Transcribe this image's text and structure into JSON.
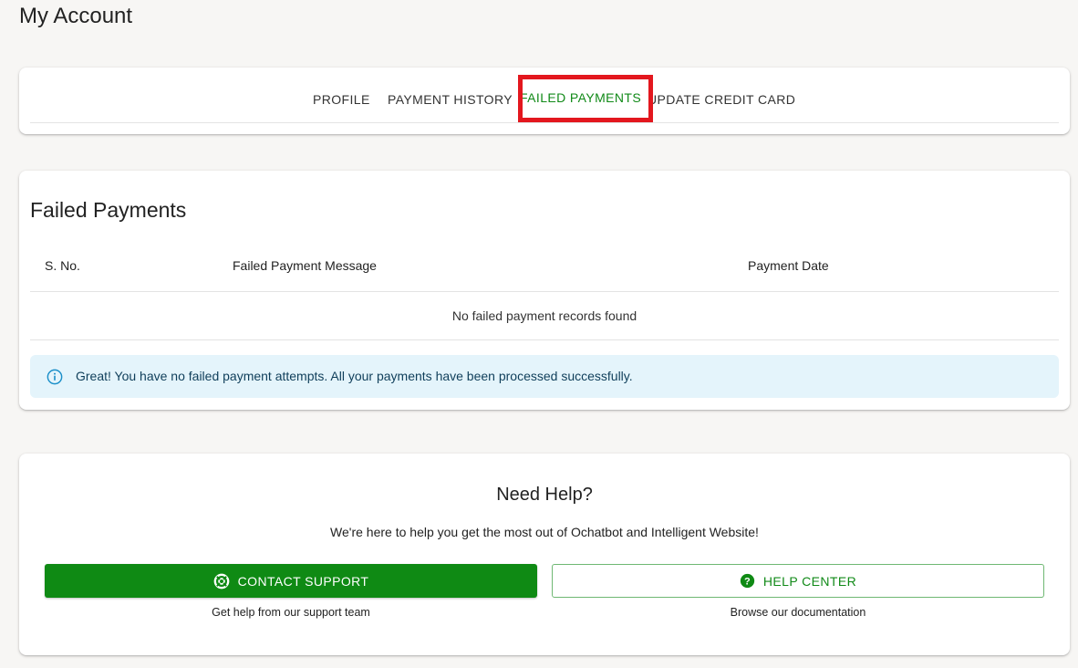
{
  "page": {
    "title": "My Account"
  },
  "tabs": [
    {
      "label": "PROFILE",
      "active": false
    },
    {
      "label": "PAYMENT HISTORY",
      "active": false
    },
    {
      "label": "FAILED PAYMENTS",
      "active": true
    },
    {
      "label": "UPDATE CREDIT CARD",
      "active": false
    }
  ],
  "failed_payments": {
    "title": "Failed Payments",
    "columns": [
      "S. No.",
      "Failed Payment Message",
      "Payment Date"
    ],
    "empty_message": "No failed payment records found",
    "alert": {
      "icon": "info-icon",
      "text": "Great! You have no failed payment attempts. All your payments have been processed successfully."
    }
  },
  "help": {
    "title": "Need Help?",
    "subtitle": "We're here to help you get the most out of Ochatbot and Intelligent Website!",
    "contact_button": {
      "label": "CONTACT SUPPORT",
      "icon": "lifebuoy-icon",
      "caption": "Get help from our support team"
    },
    "help_center_button": {
      "label": "HELP CENTER",
      "icon": "question-circle-icon",
      "caption": "Browse our documentation"
    }
  },
  "colors": {
    "accent_green": "#0f8a14",
    "highlight_red": "#e3171e",
    "alert_bg": "#e4f4fb",
    "alert_icon": "#1a8fc9"
  }
}
